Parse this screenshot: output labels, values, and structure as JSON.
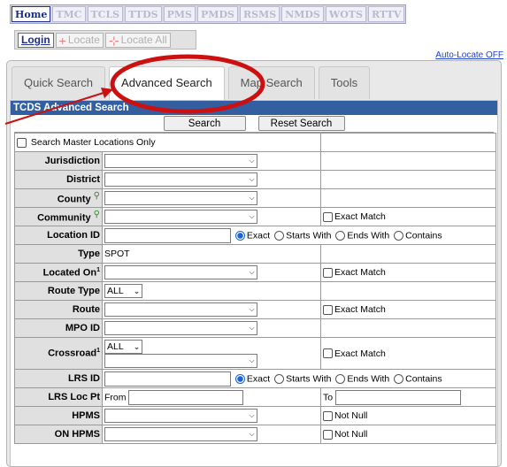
{
  "top_nav": {
    "tabs": [
      "Home",
      "TMC",
      "TCLS",
      "TTDS",
      "PMS",
      "PMDS",
      "RSMS",
      "NMDS",
      "WOTS",
      "RTTV"
    ],
    "active": "Home"
  },
  "toolbar": {
    "login": "Login",
    "locate": "Locate",
    "locate_all": "Locate All"
  },
  "auto_locate": "Auto-Locate OFF",
  "search_tabs": [
    "Quick Search",
    "Advanced Search",
    "Map Search",
    "Tools"
  ],
  "active_search_tab": "Advanced Search",
  "panel": {
    "title": "TCDS Advanced Search",
    "search_button": "Search",
    "reset_button": "Reset Search",
    "master_only_label": "Search Master Locations Only"
  },
  "fields": {
    "jurisdiction": "Jurisdiction",
    "district": "District",
    "county": "County",
    "community": "Community",
    "location_id": "Location ID",
    "type": "Type",
    "type_value": "SPOT",
    "located_on": "Located On",
    "route_type": "Route Type",
    "route_type_value": "ALL",
    "route": "Route",
    "mpo_id": "MPO ID",
    "crossroad": "Crossroad",
    "crossroad_type_value": "ALL",
    "lrs_id": "LRS ID",
    "lrs_loc_pt": "LRS Loc Pt",
    "from": "From",
    "to": "To",
    "hpms": "HPMS",
    "on_hpms": "ON HPMS",
    "footnote_mark": "1"
  },
  "options": {
    "exact_match": "Exact Match",
    "not_null": "Not Null",
    "exact": "Exact",
    "starts_with": "Starts With",
    "ends_with": "Ends With",
    "contains": "Contains"
  },
  "colors": {
    "header_blue": "#335fa0",
    "annotation_red": "#cc1010",
    "link_blue": "#1f3fd0"
  }
}
